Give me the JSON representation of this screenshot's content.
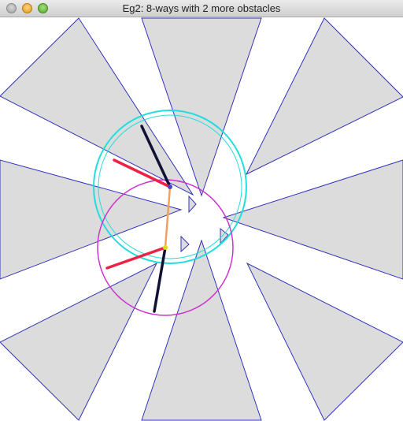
{
  "window": {
    "title": "Eg2: 8-ways with 2 more obstacles"
  },
  "colors": {
    "obstacle_fill": "#dcdcdc",
    "obstacle_stroke": "#3333bb",
    "circle_cyan": "#22dddd",
    "circle_magenta": "#cc33cc",
    "arm_red": "#ee2244",
    "arm_black": "#111133",
    "link_orange": "#f0a060",
    "joint_blue": "#4444cc",
    "joint_yellow": "#dddd00"
  },
  "icons": {
    "close": "close-button",
    "minimize": "minimize-button",
    "zoom": "zoom-button"
  }
}
